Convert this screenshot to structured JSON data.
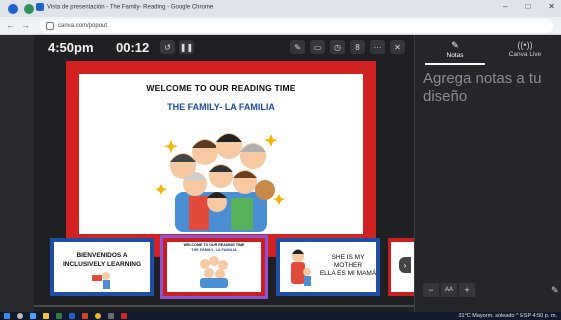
{
  "browser": {
    "window_title": "Vista de presentación - The Family- Reading - Google Chrome",
    "url": "canva.com/popout"
  },
  "presenter": {
    "clock": "4:50pm",
    "timer": "00:12"
  },
  "slide": {
    "title": "WELCOME TO OUR READING TIME",
    "subtitle": "THE FAMILY- LA FAMILIA"
  },
  "thumbnails": [
    {
      "line1": "BIENVENIDOS A",
      "line2": "INCLUSIVELY LEARNING"
    },
    {
      "line1": "WELCOME TO OUR READING TIME",
      "line2": "THE FAMILY- LA FAMILIA"
    },
    {
      "line1": "SHE IS MY MOTHER",
      "line2": "ELLA ES MI MAMÁ"
    }
  ],
  "notes_panel": {
    "tab_notes": "Notas",
    "tab_live": "Canva Live",
    "placeholder": "Agrega notas a tu diseño",
    "font_label": "AA"
  },
  "taskbar": {
    "tray_text": "31°C  Mayorm. soleado  ^  ESP  4:50 p. m."
  },
  "colors": {
    "slide_border": "#d12121",
    "subtitle": "#1a4d9c",
    "active_thumb": "#8a55d8"
  }
}
